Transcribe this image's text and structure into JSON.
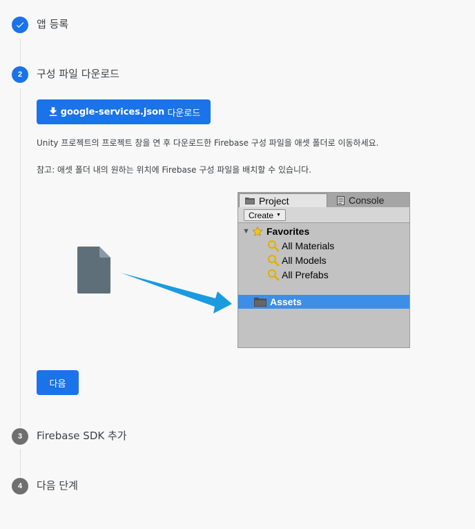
{
  "steps": [
    {
      "number": "",
      "title": "앱 등록",
      "status": "complete"
    },
    {
      "number": "2",
      "title": "구성 파일 다운로드",
      "status": "active"
    },
    {
      "number": "3",
      "title": "Firebase SDK 추가",
      "status": "pending"
    },
    {
      "number": "4",
      "title": "다음 단계",
      "status": "pending"
    }
  ],
  "download_button": {
    "filename": "google-services.json",
    "suffix": " 다운로드"
  },
  "instructions": "Unity 프로젝트의 프로젝트 창을 연 후 다운로드한 Firebase 구성 파일을 애셋 폴더로 이동하세요.",
  "note": "참고: 애셋 폴더 내의 원하는 위치에 Firebase 구성 파일을 배치할 수 있습니다.",
  "next_button": "다음",
  "unity": {
    "tabs": [
      "Project",
      "Console"
    ],
    "create_label": "Create",
    "favorites_label": "Favorites",
    "favorite_items": [
      "All Materials",
      "All Models",
      "All Prefabs"
    ],
    "assets_label": "Assets"
  },
  "colors": {
    "primary": "#1a73e8",
    "step_pending": "#6f6f6f",
    "arrow": "#1a9be0",
    "selection": "#3d8ee9"
  }
}
